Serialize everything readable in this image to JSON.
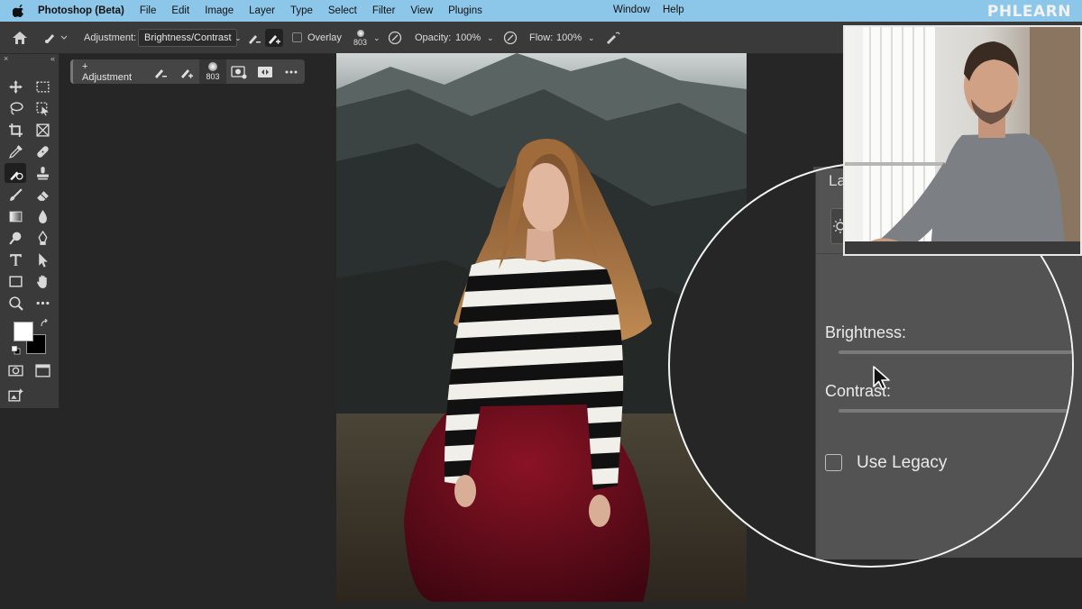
{
  "menubar": {
    "app_name": "Photoshop (Beta)",
    "items": [
      "File",
      "Edit",
      "Image",
      "Layer",
      "Type",
      "Select",
      "Filter",
      "View",
      "Plugins"
    ],
    "right_items": [
      "Window",
      "Help"
    ],
    "brand": "PHLEARN",
    "background_color": "#8cc6e8"
  },
  "options_bar": {
    "adjustment_label": "Adjustment:",
    "adjustment_value": "Brightness/Contrast",
    "overlay_label": "Overlay",
    "brush_size": "803",
    "opacity_label": "Opacity:",
    "opacity_value": "100%",
    "flow_label": "Flow:",
    "flow_value": "100%"
  },
  "toolbox": {
    "header_left": "×",
    "header_right": "«",
    "tools": [
      "move-tool-icon",
      "marquee-tool-icon",
      "lasso-tool-icon",
      "object-select-tool-icon",
      "crop-tool-icon",
      "frame-tool-icon",
      "eyedropper-tool-icon",
      "healing-brush-icon",
      "adjustment-brush-icon",
      "stamp-tool-icon",
      "brush-tool-icon",
      "eraser-tool-icon",
      "gradient-tool-icon",
      "blur-tool-icon",
      "dodge-tool-icon",
      "pen-tool-icon",
      "type-tool-icon",
      "path-select-icon",
      "rectangle-tool-icon",
      "hand-tool-icon",
      "zoom-tool-icon",
      "more-tools-icon"
    ],
    "active_tool": "adjustment-brush-icon"
  },
  "context_bar": {
    "add_label": "+ Adjustment",
    "brush_size": "803"
  },
  "properties_panel": {
    "tab_fragment": "La",
    "brightness_label": "Brightness:",
    "contrast_label": "Contrast:",
    "legacy_label": "Use Legacy",
    "legacy_checked": false
  },
  "colors": {
    "foreground": "#ffffff",
    "background": "#000000"
  }
}
